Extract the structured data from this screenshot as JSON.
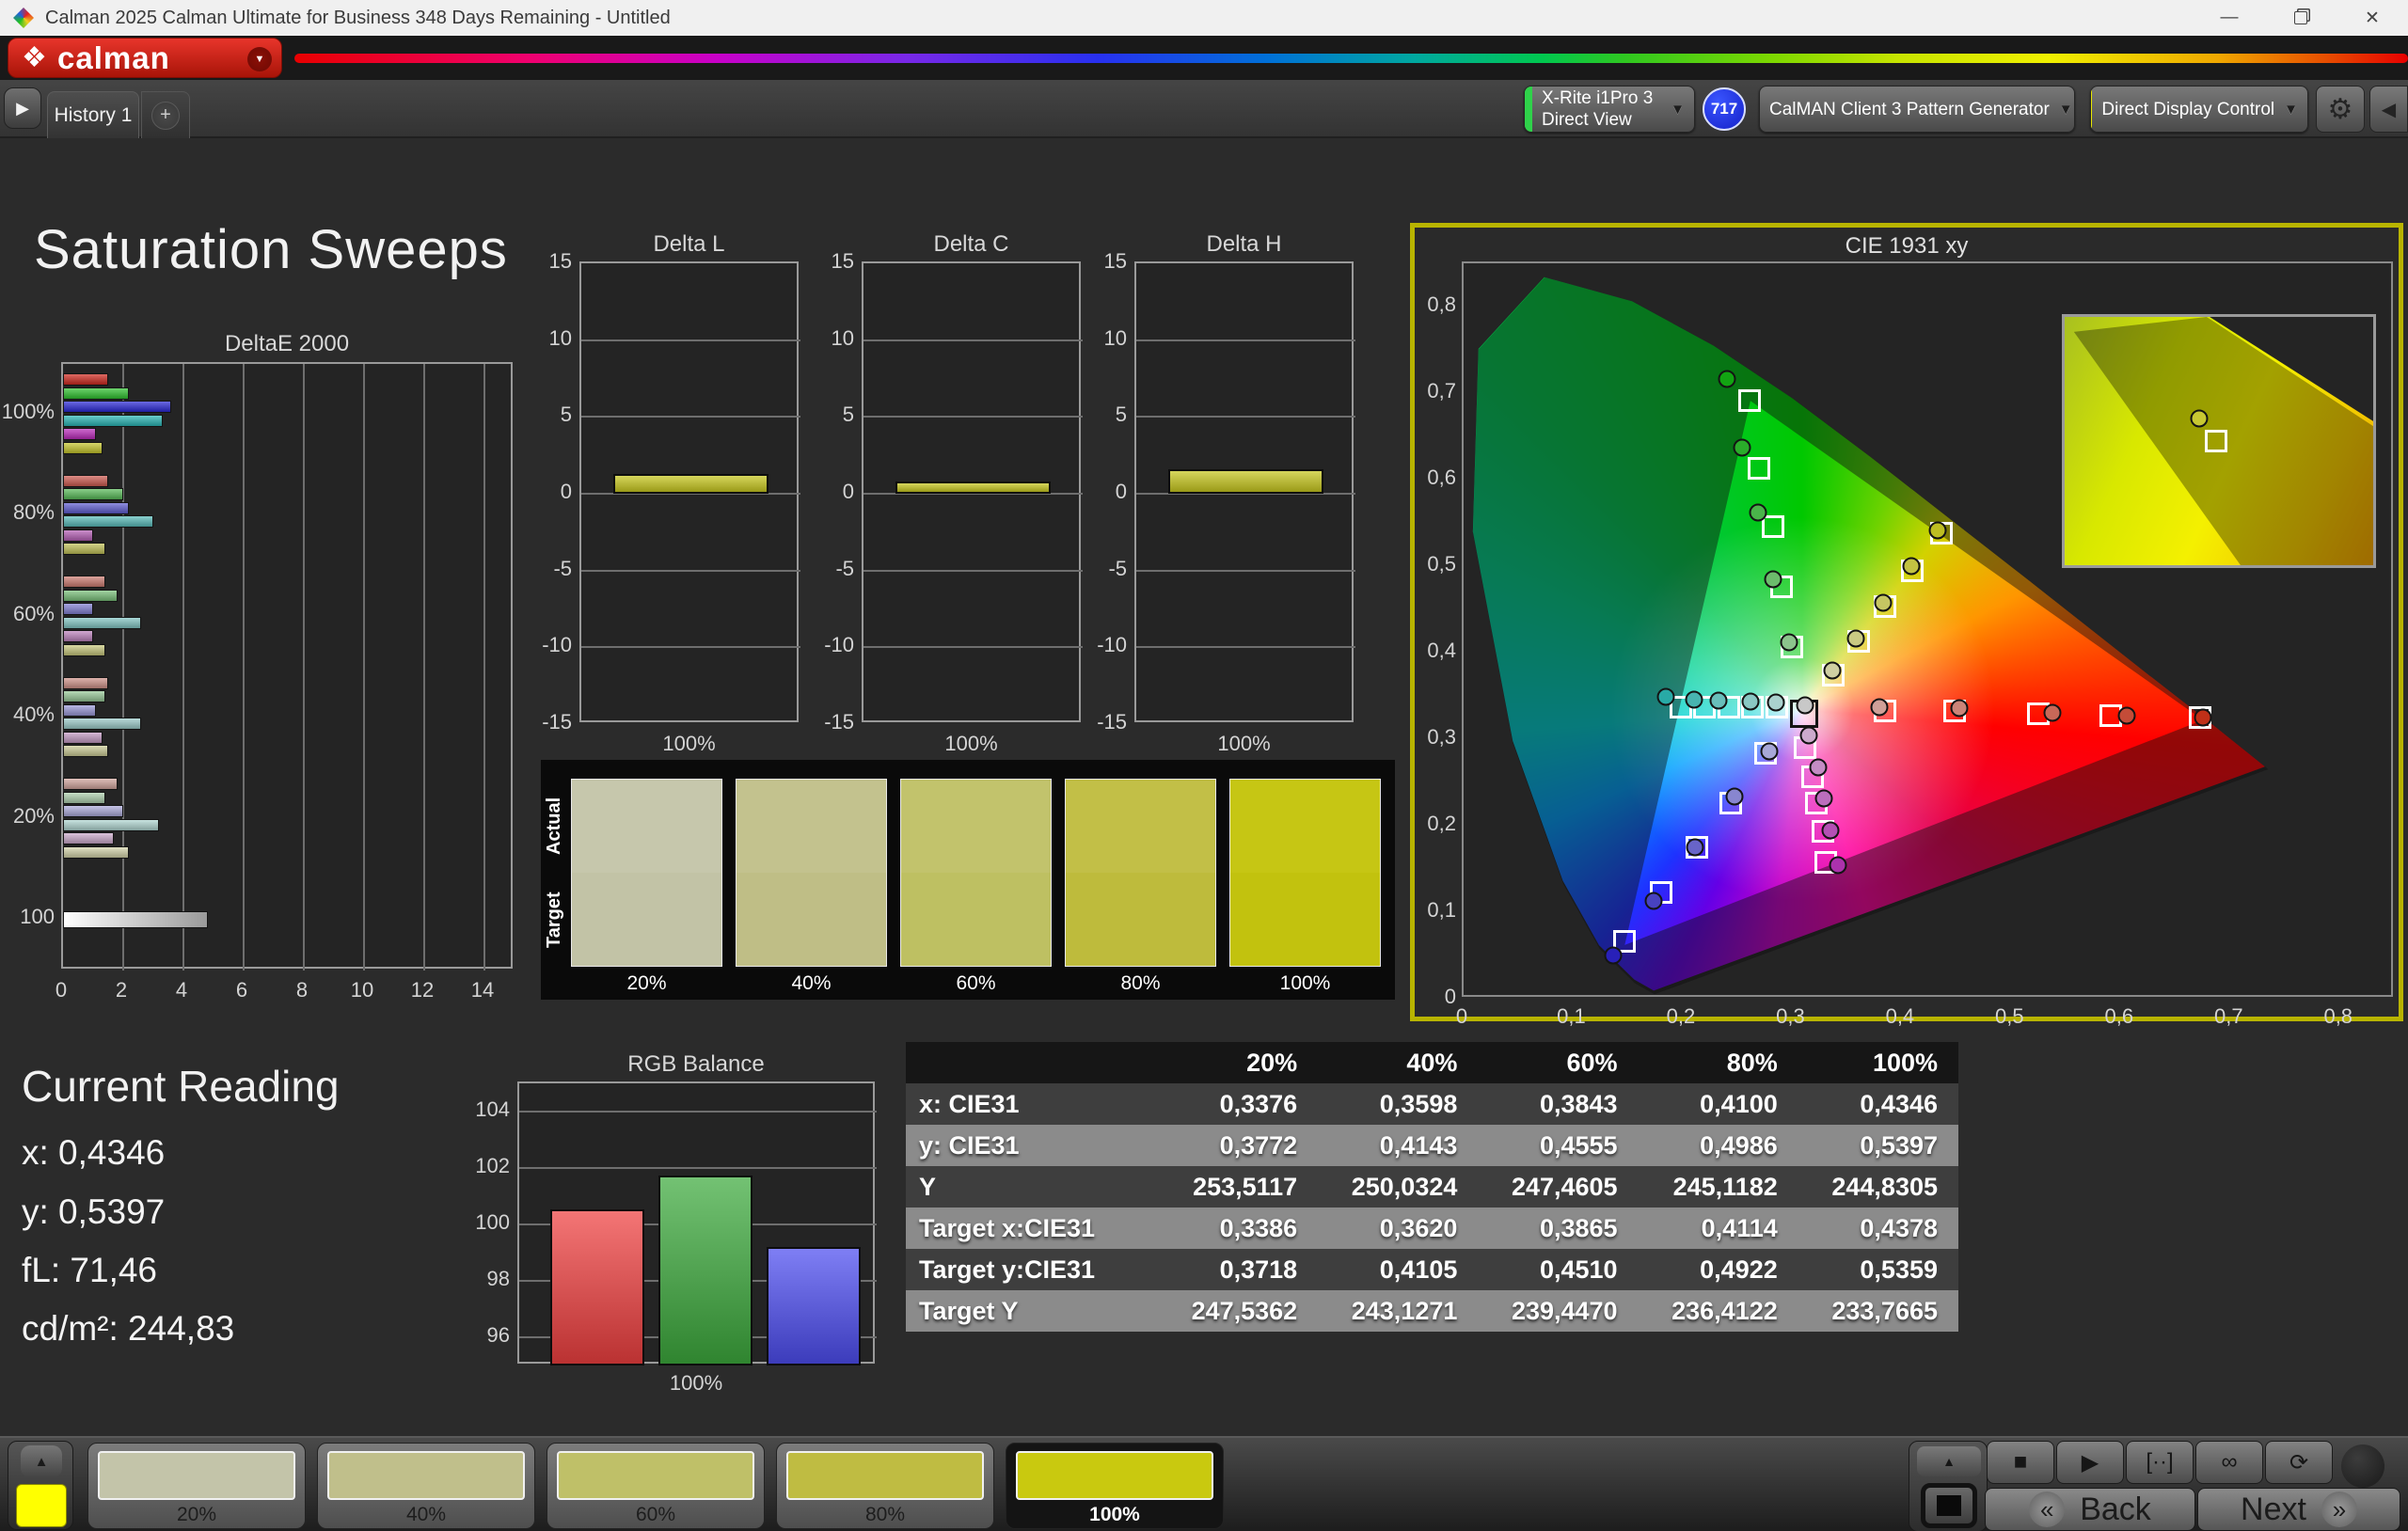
{
  "window": {
    "title": "Calman 2025 Calman Ultimate for Business 348 Days Remaining  - Untitled",
    "minimize_glyph": "—",
    "close_glyph": "✕"
  },
  "brand": {
    "logo_glyph": "❖",
    "logo_text": "calman",
    "dropdown_glyph": "▼"
  },
  "tabbar": {
    "nav_arrow_glyph": "▶",
    "history_tab_label": "History 1",
    "add_tab_glyph": "+",
    "meter_line1": "X-Rite i1Pro 3",
    "meter_line2": "Direct View",
    "meter_badge": "717",
    "source_label": "CalMAN Client 3 Pattern Generator",
    "display_label": "Direct Display Control",
    "gear_glyph": "⚙",
    "collapse_glyph": "◀",
    "chevron_glyph": "▼",
    "meter_stripe_color": "#2fd24a",
    "source_stripe_color": "#2fd24a",
    "display_stripe_color": "#e8e800"
  },
  "page": {
    "title": "Saturation Sweeps"
  },
  "chart_data": {
    "deltae": {
      "type": "bar",
      "title": "DeltaE 2000",
      "xticks": [
        0,
        2,
        4,
        6,
        8,
        10,
        12,
        14
      ],
      "xmax": 15,
      "groups": [
        {
          "label": "100%",
          "values": [
            1.5,
            2.2,
            3.6,
            3.3,
            1.1,
            1.3
          ],
          "colors": [
            "#d0281e",
            "#2ec22e",
            "#2a28d6",
            "#28b6b6",
            "#bc2abc",
            "#c6c62a"
          ]
        },
        {
          "label": "80%",
          "values": [
            1.5,
            2.0,
            2.2,
            3.0,
            1.0,
            1.4
          ],
          "colors": [
            "#cf5a50",
            "#57bb57",
            "#5e5cd2",
            "#58bcba",
            "#b55eb5",
            "#c2c257"
          ]
        },
        {
          "label": "60%",
          "values": [
            1.4,
            1.8,
            1.0,
            2.6,
            1.0,
            1.4
          ],
          "colors": [
            "#cd7b71",
            "#79c079",
            "#8280d4",
            "#82c6c4",
            "#bd82bd",
            "#c8c87c"
          ]
        },
        {
          "label": "40%",
          "values": [
            1.5,
            1.4,
            1.1,
            2.6,
            1.3,
            1.5
          ],
          "colors": [
            "#cf9188",
            "#97c897",
            "#9a98d8",
            "#9cccca",
            "#c49ac4",
            "#cccc96"
          ]
        },
        {
          "label": "20%",
          "values": [
            1.8,
            1.4,
            2.0,
            3.2,
            1.7,
            2.2
          ],
          "colors": [
            "#d2a59d",
            "#aed0ae",
            "#acaadb",
            "#b0d6d2",
            "#ccaacc",
            "#d4d4aa"
          ]
        },
        {
          "label": "100",
          "values": [
            4.8
          ],
          "colors": [
            "white"
          ]
        }
      ]
    },
    "delta_small": {
      "type": "bar",
      "yticks": [
        15,
        10,
        5,
        0,
        -5,
        -10,
        -15
      ],
      "xlabel": "100%",
      "bar_color": "#c6c61e",
      "charts": [
        {
          "title": "Delta L",
          "value": 1.3
        },
        {
          "title": "Delta C",
          "value": 0.8
        },
        {
          "title": "Delta H",
          "value": 1.6
        }
      ]
    },
    "rgb_balance": {
      "type": "bar",
      "title": "RGB Balance",
      "yticks": [
        104,
        102,
        100,
        98,
        96
      ],
      "ymin": 95,
      "ymax": 105,
      "categories": [
        "Red",
        "Green",
        "Blue"
      ],
      "values": [
        100.55,
        101.75,
        99.2
      ],
      "colors": [
        "#ef4040",
        "#3daa3d",
        "#4d4df0"
      ],
      "xlabel": "100%"
    },
    "cie": {
      "type": "scatter",
      "title": "CIE 1931 xy",
      "xticks": [
        "0",
        "0,1",
        "0,2",
        "0,3",
        "0,4",
        "0,5",
        "0,6",
        "0,7",
        "0,8"
      ],
      "yticks": [
        "0,8",
        "0,7",
        "0,6",
        "0,5",
        "0,4",
        "0,3",
        "0,2",
        "0,1",
        "0"
      ],
      "axis_range": 0.85,
      "wp_square": [
        0.312,
        0.327
      ],
      "squares": [
        [
          0.301,
          0.404
        ],
        [
          0.291,
          0.474
        ],
        [
          0.284,
          0.544
        ],
        [
          0.271,
          0.612
        ],
        [
          0.262,
          0.691
        ],
        [
          0.3386,
          0.3718
        ],
        [
          0.362,
          0.4105
        ],
        [
          0.3865,
          0.451
        ],
        [
          0.4114,
          0.4922
        ],
        [
          0.4378,
          0.5359
        ],
        [
          0.287,
          0.334
        ],
        [
          0.265,
          0.334
        ],
        [
          0.243,
          0.334
        ],
        [
          0.221,
          0.334
        ],
        [
          0.199,
          0.334
        ],
        [
          0.386,
          0.33
        ],
        [
          0.45,
          0.33
        ],
        [
          0.527,
          0.327
        ],
        [
          0.593,
          0.325
        ],
        [
          0.675,
          0.322
        ],
        [
          0.313,
          0.287
        ],
        [
          0.32,
          0.254
        ],
        [
          0.323,
          0.223
        ],
        [
          0.329,
          0.19
        ],
        [
          0.332,
          0.154
        ],
        [
          0.277,
          0.281
        ],
        [
          0.245,
          0.223
        ],
        [
          0.214,
          0.171
        ],
        [
          0.181,
          0.119
        ],
        [
          0.147,
          0.062
        ]
      ],
      "circles": [
        [
          0.298,
          0.41,
          "#8cc48c"
        ],
        [
          0.284,
          0.483,
          "#6cbc6c"
        ],
        [
          0.27,
          0.56,
          "#4ab44a"
        ],
        [
          0.255,
          0.636,
          "#2aac2a"
        ],
        [
          0.241,
          0.716,
          "#12a412"
        ],
        [
          0.3376,
          0.3772,
          "#cfcfa2"
        ],
        [
          0.3598,
          0.4143,
          "#caca82"
        ],
        [
          0.3843,
          0.4555,
          "#c6c662"
        ],
        [
          0.41,
          0.4986,
          "#c2c242"
        ],
        [
          0.4346,
          0.5397,
          "#bebe22"
        ],
        [
          0.286,
          0.34,
          "#aad2ce"
        ],
        [
          0.263,
          0.341,
          "#8ac8c4"
        ],
        [
          0.234,
          0.342,
          "#68beba"
        ],
        [
          0.211,
          0.343,
          "#48b4b0"
        ],
        [
          0.185,
          0.346,
          "#28aaa6"
        ],
        [
          0.381,
          0.334,
          "#d0a098"
        ],
        [
          0.454,
          0.333,
          "#cc8478"
        ],
        [
          0.54,
          0.328,
          "#c86858"
        ],
        [
          0.608,
          0.325,
          "#c44c38"
        ],
        [
          0.678,
          0.322,
          "#c03018"
        ],
        [
          0.316,
          0.301,
          "#ccaacc"
        ],
        [
          0.325,
          0.264,
          "#c48cc4"
        ],
        [
          0.33,
          0.228,
          "#bc6ebc"
        ],
        [
          0.336,
          0.191,
          "#b450b4"
        ],
        [
          0.343,
          0.151,
          "#ac32ac"
        ],
        [
          0.28,
          0.283,
          "#a8a8d8"
        ],
        [
          0.248,
          0.231,
          "#8886d0"
        ],
        [
          0.212,
          0.171,
          "#6864c8"
        ],
        [
          0.174,
          0.109,
          "#4842c0"
        ],
        [
          0.137,
          0.046,
          "#2820b8"
        ],
        [
          0.313,
          0.336,
          "#c8c8c8"
        ]
      ],
      "inset": {
        "circle": [
          0.435,
          0.41
        ],
        "circle_fill": "#c8c832",
        "square": [
          0.49,
          0.5
        ]
      }
    }
  },
  "swatch_strip": {
    "row_labels": [
      "Actual",
      "Target"
    ],
    "items": [
      {
        "label": "20%",
        "top": "#c6c7ac",
        "bottom": "#c2c3a6"
      },
      {
        "label": "40%",
        "top": "#c3c28e",
        "bottom": "#bfbe86"
      },
      {
        "label": "60%",
        "top": "#c2c36c",
        "bottom": "#bec062"
      },
      {
        "label": "80%",
        "top": "#c2bf47",
        "bottom": "#bebb3c"
      },
      {
        "label": "100%",
        "top": "#c6c614",
        "bottom": "#c2c20e"
      }
    ]
  },
  "current_reading": {
    "title": "Current Reading",
    "lines": [
      "x: 0,4346",
      "y: 0,5397",
      "fL: 71,46",
      "cd/m²: 244,83"
    ]
  },
  "table": {
    "headers": [
      "",
      "20%",
      "40%",
      "60%",
      "80%",
      "100%"
    ],
    "rows": [
      {
        "label": "x: CIE31",
        "values": [
          "0,3376",
          "0,3598",
          "0,3843",
          "0,4100",
          "0,4346"
        ]
      },
      {
        "label": "y: CIE31",
        "values": [
          "0,3772",
          "0,4143",
          "0,4555",
          "0,4986",
          "0,5397"
        ]
      },
      {
        "label": "Y",
        "values": [
          "253,5117",
          "250,0324",
          "247,4605",
          "245,1182",
          "244,8305"
        ]
      },
      {
        "label": "Target x:CIE31",
        "values": [
          "0,3386",
          "0,3620",
          "0,3865",
          "0,4114",
          "0,4378"
        ]
      },
      {
        "label": "Target y:CIE31",
        "values": [
          "0,3718",
          "0,4105",
          "0,4510",
          "0,4922",
          "0,5359"
        ]
      },
      {
        "label": "Target Y",
        "values": [
          "247,5362",
          "243,1271",
          "239,4470",
          "236,4122",
          "233,7665"
        ]
      }
    ]
  },
  "bottom": {
    "up_arrow_glyph": "▲",
    "active_swatch_color": "#ffff00",
    "patterns": [
      {
        "label": "20%",
        "color": "#c3c4a9",
        "selected": false
      },
      {
        "label": "40%",
        "color": "#c0bf8b",
        "selected": false
      },
      {
        "label": "60%",
        "color": "#bfc068",
        "selected": false
      },
      {
        "label": "80%",
        "color": "#bfbc42",
        "selected": false
      },
      {
        "label": "100%",
        "color": "#c9c90f",
        "selected": true
      }
    ],
    "transport": [
      {
        "name": "stop-button",
        "glyph": "■"
      },
      {
        "name": "play-button",
        "glyph": "▶"
      },
      {
        "name": "step-button",
        "glyph": "[··]"
      },
      {
        "name": "loop-button",
        "glyph": "∞"
      },
      {
        "name": "refresh-button",
        "glyph": "⟳"
      }
    ],
    "back_label": "Back",
    "next_label": "Next",
    "back_icon": "«",
    "next_icon": "»",
    "display_toggle_arrow": "▲"
  }
}
